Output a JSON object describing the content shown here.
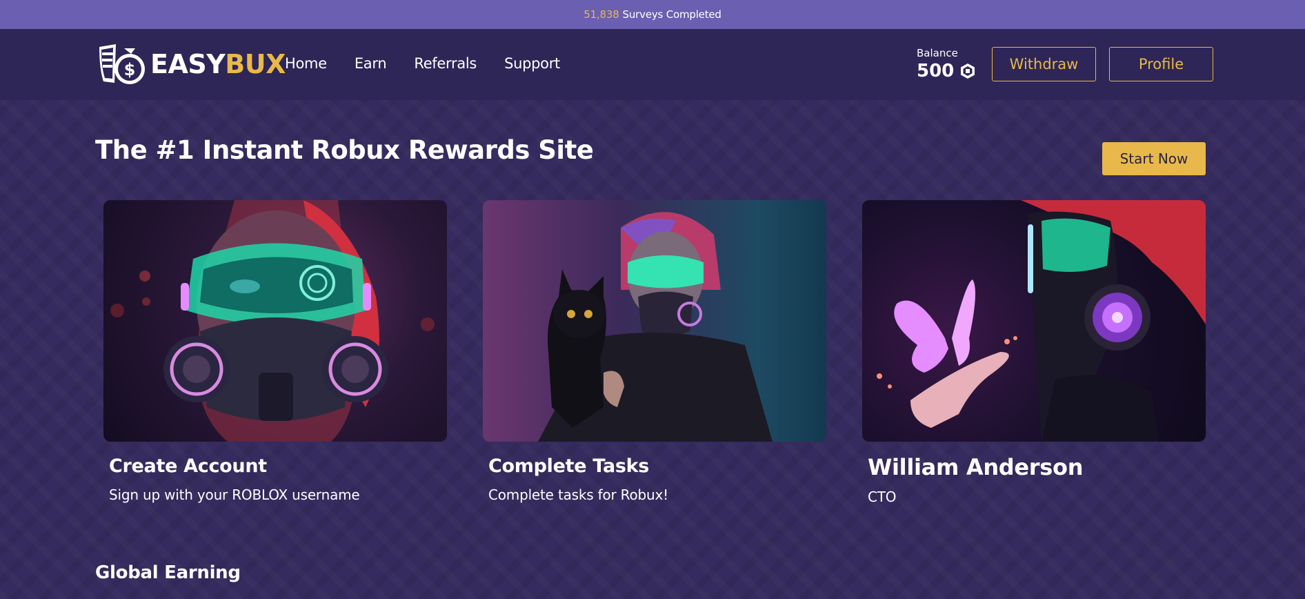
{
  "banner": {
    "count": "51,838",
    "text": "Surveys Completed"
  },
  "logo": {
    "easy": "EASY",
    "bux": "BUX"
  },
  "nav": {
    "items": [
      {
        "label": "Home"
      },
      {
        "label": "Earn"
      },
      {
        "label": "Referrals"
      },
      {
        "label": "Support"
      }
    ]
  },
  "balance": {
    "label": "Balance",
    "value": "500",
    "icon": "robux-icon"
  },
  "buttons": {
    "withdraw": "Withdraw",
    "profile": "Profile",
    "start": "Start Now"
  },
  "hero": {
    "title": "The #1 Instant Robux Rewards Site"
  },
  "cards": [
    {
      "title": "Create Account",
      "subtitle": "Sign up with your ROBLOX username",
      "image": "cyberpunk-girl-gas-mask-image"
    },
    {
      "title": "Complete Tasks",
      "subtitle": "Complete tasks for Robux!",
      "image": "cyberpunk-girl-with-black-cat-image"
    },
    {
      "title": "William Anderson",
      "subtitle": "CTO",
      "image": "cyberpunk-girl-with-butterfly-image"
    }
  ],
  "sections": {
    "global_earning": "Global Earning"
  },
  "colors": {
    "accent": "#e8b94a",
    "banner": "#6a5fb1",
    "navbar": "#2e2656",
    "background": "#352b5e"
  }
}
